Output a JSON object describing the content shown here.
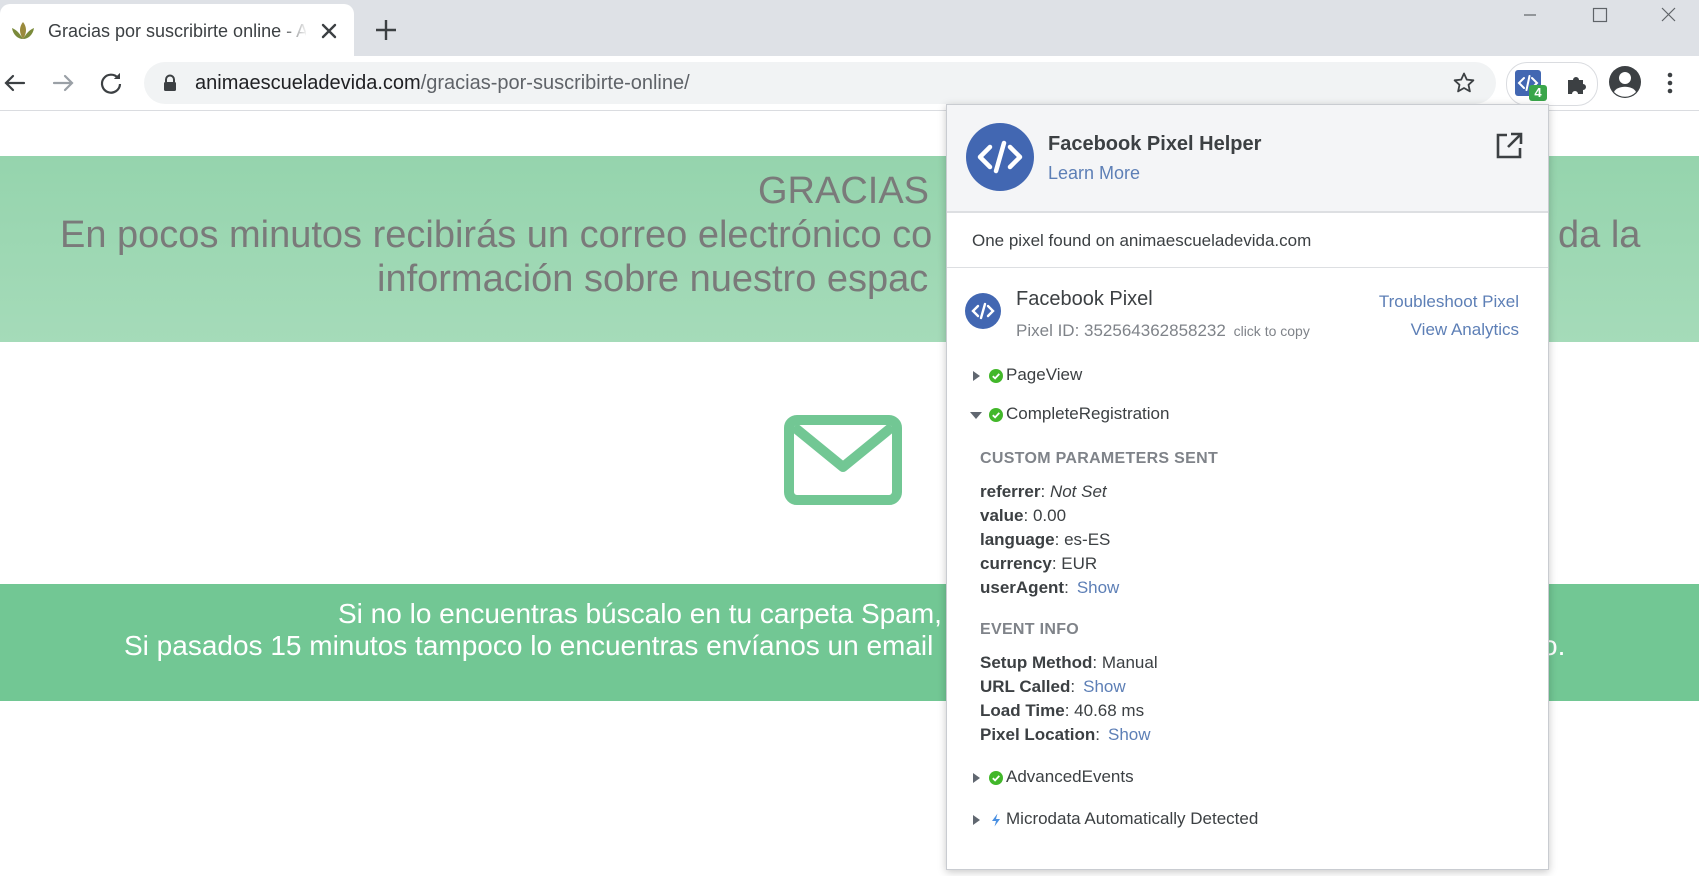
{
  "browser": {
    "tab_title": "Gracias por suscribirte online - AI",
    "url_host": "animaescueladevida.com",
    "url_path": "/gracias-por-suscribirte-online/",
    "extension_badge": "4"
  },
  "page": {
    "heading": "GRACIAS",
    "line1_start": "En pocos minutos recibirás un correo electrónico co",
    "line1_end": "da la",
    "line2": "información sobre nuestro espac",
    "band2_line1": "Si no lo encuentras búscalo en tu carpeta Spam,",
    "band2_line2": "Si pasados 15 minutos tampoco lo encuentras envíanos un email",
    "band2_line2_end": "o.",
    "colors": {
      "band_top": "#95d4ad",
      "band_bottom": "#72c794",
      "envelope": "#72c794"
    }
  },
  "popup": {
    "title": "Facebook Pixel Helper",
    "learn_more": "Learn More",
    "found_text": "One pixel found on animaescueladevida.com",
    "pixel_name": "Facebook Pixel",
    "pixel_id": "Pixel ID: 352564362858232",
    "click_to_copy": "click to copy",
    "troubleshoot": "Troubleshoot Pixel",
    "view_analytics": "View Analytics",
    "events": [
      {
        "label": "PageView",
        "expanded": false,
        "status": "success"
      },
      {
        "label": "CompleteRegistration",
        "expanded": true,
        "status": "success"
      },
      {
        "label": "AdvancedEvents",
        "expanded": false,
        "status": "success"
      },
      {
        "label": "Microdata Automatically Detected",
        "expanded": false,
        "status": "info"
      }
    ],
    "custom_params_heading": "CUSTOM PARAMETERS SENT",
    "custom_params": [
      {
        "key": "referrer",
        "value": "Not Set"
      },
      {
        "key": "value",
        "value": "0.00"
      },
      {
        "key": "language",
        "value": "es-ES"
      },
      {
        "key": "currency",
        "value": "EUR"
      },
      {
        "key": "userAgent",
        "value": "Show"
      }
    ],
    "event_info_heading": "EVENT INFO",
    "event_info": [
      {
        "key": "Setup Method",
        "value": "Manual"
      },
      {
        "key": "URL Called",
        "value": "Show"
      },
      {
        "key": "Load Time",
        "value": "40.68 ms"
      },
      {
        "key": "Pixel Location",
        "value": "Show"
      }
    ],
    "colors": {
      "brand": "#4267b2",
      "link": "#5d7fb6",
      "success": "#42b72a",
      "info": "#4a90e2"
    }
  }
}
